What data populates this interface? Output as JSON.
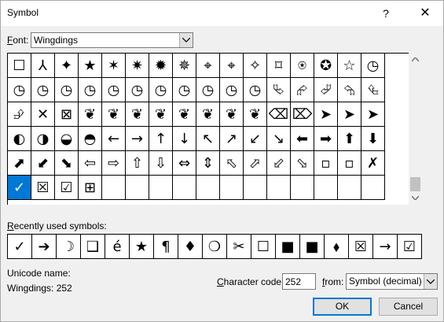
{
  "window": {
    "title": "Symbol",
    "help_label": "?",
    "close_label": "✕"
  },
  "font": {
    "label_prefix": "F",
    "label_rest": "ont:",
    "value": "Wingdings"
  },
  "symbols": [
    "☐",
    "⅄",
    "✦",
    "★",
    "✶",
    "✷",
    "✹",
    "✵",
    "⌖",
    "⌖",
    "✧",
    "⌑",
    "⍟",
    "✪",
    "☆",
    "◷",
    "◷",
    "◷",
    "◷",
    "◷",
    "◷",
    "◷",
    "◷",
    "◷",
    "◷",
    "◷",
    "◷",
    "⮱",
    "⮳",
    "⮰",
    "⮲",
    "⮴",
    "⮵",
    "✕",
    "⊠",
    "❦",
    "❦",
    "❦",
    "❦",
    "❦",
    "❦",
    "❦",
    "❦",
    "⌫",
    "⌦",
    "➤",
    "➤",
    "➤",
    "◐",
    "◑",
    "◒",
    "◓",
    "←",
    "→",
    "↑",
    "↓",
    "↖",
    "↗",
    "↙",
    "↘",
    "⬅",
    "➡",
    "⬆",
    "⬇",
    "⬈",
    "⬋",
    "⬊",
    "⇦",
    "⇨",
    "⇧",
    "⇩",
    "⇔",
    "⇕",
    "⬁",
    "⬀",
    "⬃",
    "⬂",
    "▫",
    "▫",
    "✗",
    "✓",
    "☒",
    "☑",
    "⊞",
    "",
    "",
    "",
    "",
    "",
    "",
    "",
    "",
    "",
    "",
    "",
    ""
  ],
  "selected_index": 80,
  "recent": {
    "label_prefix": "R",
    "label_rest": "ecently used symbols:",
    "symbols": [
      "✓",
      "➔",
      "☽",
      "❑",
      "é",
      "★",
      "¶",
      "♦",
      "❍",
      "✂",
      "☐",
      "■",
      "■",
      "⬧",
      "☒",
      "→",
      "☑"
    ]
  },
  "unicode": {
    "name_label": "Unicode name:",
    "name_value": "Wingdings: 252"
  },
  "char_code": {
    "label_prefix": "C",
    "label_rest": "haracter code:",
    "value": "252"
  },
  "from": {
    "label_prefix": "f",
    "label_rest": "rom:",
    "value": "Symbol (decimal)"
  },
  "buttons": {
    "ok": "OK",
    "cancel": "Cancel"
  }
}
